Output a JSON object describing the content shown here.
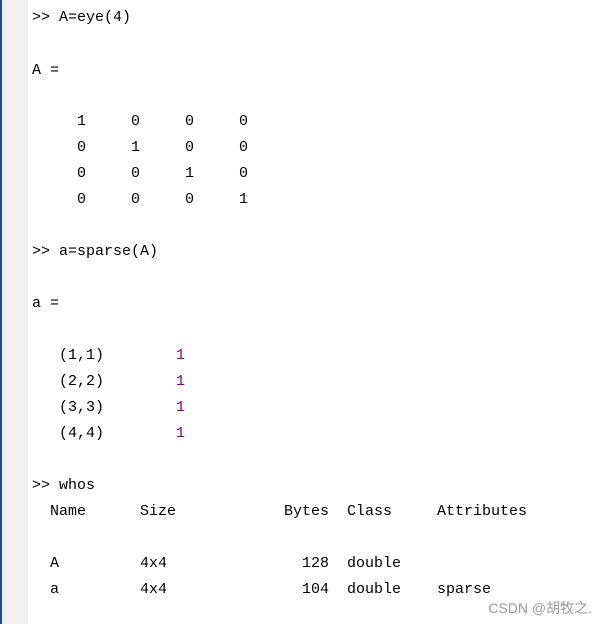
{
  "command_window": {
    "prompt": ">>",
    "cmd1": "A=eye(4)",
    "out1_label": "A =",
    "matrix": [
      [
        "1",
        "0",
        "0",
        "0"
      ],
      [
        "0",
        "1",
        "0",
        "0"
      ],
      [
        "0",
        "0",
        "1",
        "0"
      ],
      [
        "0",
        "0",
        "0",
        "1"
      ]
    ],
    "cmd2": "a=sparse(A)",
    "out2_label": "a =",
    "sparse_entries": [
      {
        "index": "(1,1)",
        "value": "1"
      },
      {
        "index": "(2,2)",
        "value": "1"
      },
      {
        "index": "(3,3)",
        "value": "1"
      },
      {
        "index": "(4,4)",
        "value": "1"
      }
    ],
    "cmd3": "whos",
    "whos_headers": [
      "Name",
      "Size",
      "Bytes",
      "Class",
      "Attributes"
    ],
    "whos_rows": [
      [
        "A",
        "4x4",
        "128",
        "double",
        ""
      ],
      [
        "a",
        "4x4",
        "104",
        "double",
        "sparse"
      ]
    ]
  },
  "watermark": "CSDN @胡牧之.",
  "colors": {
    "sparse_value": "#800080",
    "gutter": "#f0f0f0",
    "border": "#1f4e8c"
  }
}
